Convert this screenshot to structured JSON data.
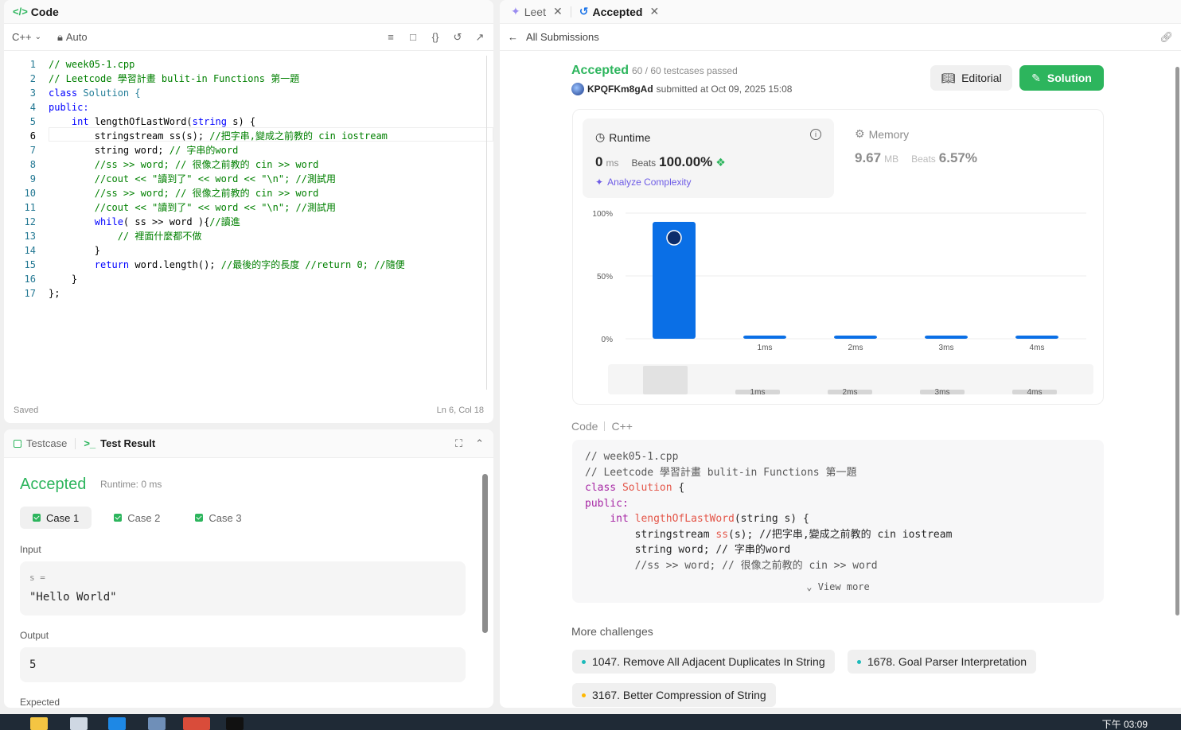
{
  "code_panel": {
    "title": "Code",
    "language": "C++",
    "mode": "Auto",
    "status_left": "Saved",
    "status_right": "Ln 6, Col 18",
    "lines": [
      {
        "n": "1"
      },
      {
        "n": "2"
      },
      {
        "n": "3"
      },
      {
        "n": "4"
      },
      {
        "n": "5"
      },
      {
        "n": "6"
      },
      {
        "n": "7"
      },
      {
        "n": "8"
      },
      {
        "n": "9"
      },
      {
        "n": "10"
      },
      {
        "n": "11"
      },
      {
        "n": "12"
      },
      {
        "n": "13"
      },
      {
        "n": "14"
      },
      {
        "n": "15"
      },
      {
        "n": "16"
      },
      {
        "n": "17"
      }
    ],
    "code": {
      "l1": "// week05-1.cpp",
      "l2": "// Leetcode 學習計畫 bulit-in Functions 第一題",
      "l3a": "class",
      "l3b": " Solution {",
      "l4": "public:",
      "l5a": "    ",
      "l5b": "int",
      "l5c": " lengthOfLastWord(",
      "l5d": "string",
      "l5e": " s) {",
      "l6a": "        stringstream ss(s); ",
      "l6b": "//把字串,變成之前教的 cin iostream",
      "l7a": "        string word; ",
      "l7b": "// 字串的word",
      "l8": "        //ss >> word; // 很像之前教的 cin >> word",
      "l9": "        //cout << \"讀到了\" << word << \"\\n\"; //測試用",
      "l10": "        //ss >> word; // 很像之前教的 cin >> word",
      "l11": "        //cout << \"讀到了\" << word << \"\\n\"; //測試用",
      "l12a": "        ",
      "l12b": "while",
      "l12c": "( ss >> word ){",
      "l12d": "//讀進",
      "l13": "            // 裡面什麼都不做",
      "l14": "        }",
      "l15a": "        ",
      "l15b": "return",
      "l15c": " word.length(); ",
      "l15d": "//最後的字的長度 //return 0; //隨便",
      "l16": "    }",
      "l17": "};"
    }
  },
  "test_panel": {
    "tab_testcase": "Testcase",
    "tab_result": "Test Result",
    "result": "Accepted",
    "runtime": "Runtime: 0 ms",
    "cases": [
      "Case 1",
      "Case 2",
      "Case 3"
    ],
    "input_label": "Input",
    "input_var": "s =",
    "input_value": "\"Hello World\"",
    "output_label": "Output",
    "output_value": "5",
    "expected_label": "Expected"
  },
  "right_panel": {
    "tabs": [
      {
        "label": "Leet"
      },
      {
        "label": "Accepted"
      }
    ],
    "back_label": "All Submissions",
    "status": "Accepted",
    "passed": "60 / 60 testcases passed",
    "username": "KPQFKm8gAd",
    "submitted": "submitted at Oct 09, 2025 15:08",
    "editorial_btn": "Editorial",
    "solution_btn": "Solution",
    "runtime": {
      "label": "Runtime",
      "value": "0",
      "unit": "ms",
      "beats_label": "Beats",
      "beats_value": "100.00%",
      "analyze": "Analyze Complexity"
    },
    "memory": {
      "label": "Memory",
      "value": "9.67",
      "unit": "MB",
      "beats_label": "Beats",
      "beats_value": "6.57%"
    },
    "code_label": "Code",
    "code_lang": "C++",
    "code_preview": {
      "p1": "// week05-1.cpp",
      "p2": "// Leetcode 學習計畫 bulit-in Functions 第一題",
      "p3a": "class",
      "p3b": " Solution",
      "p3c": " {",
      "p4": "public:",
      "p5a": "    ",
      "p5b": "int",
      "p5c": " lengthOfLastWord",
      "p5d": "(string s) {",
      "p6a": "        stringstream ",
      "p6b": "ss",
      "p6c": "(s); //把字串,變成之前教的 cin iostream",
      "p7": "        string word; // 字串的word",
      "p8": "        //ss >> word; // 很像之前教的 cin >> word"
    },
    "view_more": "View more",
    "more_label": "More challenges",
    "challenges": [
      {
        "label": "1047. Remove All Adjacent Duplicates In String",
        "color": "#1cbaba"
      },
      {
        "label": "1678. Goal Parser Interpretation",
        "color": "#1cbaba"
      },
      {
        "label": "3167. Better Compression of String",
        "color": "#ffb800"
      }
    ]
  },
  "chart_data": {
    "type": "bar",
    "title": "",
    "xlabel": "",
    "ylabel": "",
    "categories": [
      "",
      "1ms",
      "2ms",
      "3ms",
      "4ms"
    ],
    "values": [
      93,
      1,
      1,
      1,
      1
    ],
    "ylim": [
      0,
      100
    ],
    "yticks": [
      "0%",
      "50%",
      "100%"
    ],
    "grid": true,
    "bar_color": "#0a6fe6"
  },
  "taskbar": {
    "clock": "下午 03:09"
  }
}
